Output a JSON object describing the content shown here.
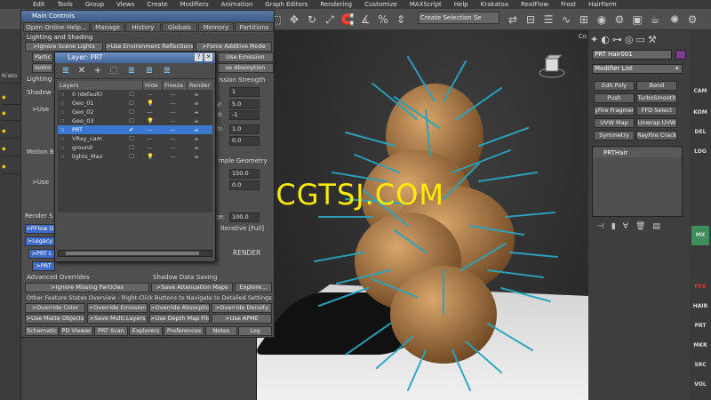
{
  "menu": [
    "Edit",
    "Tools",
    "Group",
    "Views",
    "Create",
    "Modifiers",
    "Animation",
    "Graph Editors",
    "Rendering",
    "Customize",
    "MAXScript",
    "Help",
    "Krakatoa",
    "RealFlow",
    "Frost",
    "HairFarm"
  ],
  "toolbar": {
    "selection_set": "Create Selection Se"
  },
  "left_strip": [
    "Krako",
    "Lighting",
    "Shadow"
  ],
  "main_controls": {
    "title": "Main Controls",
    "tabs": [
      "Open Online Help...",
      "Manage",
      "History",
      "Globals",
      "Memory",
      "Partitions"
    ],
    "lighting_section": "Lighting and Shading",
    "buttons_row1": [
      ">Ignore Scene Lights",
      ">Use Environment Reflections",
      ">Force Additive Mode"
    ],
    "partial_labels": [
      "Partic",
      "Isotro",
      "Lighting",
      "Shadow",
      "Motion B",
      "Render S"
    ],
    "use_labels": [
      ">Use",
      ">Use"
    ],
    "pflow": [
      ">PFlow G",
      ">Legacy",
      ">PRT L",
      ">PRT"
    ],
    "advanced_overrides": "Advanced Overrides",
    "ignore_missing": ">Ignore Missing Particles",
    "shadow_saving": "Shadow Data Saving",
    "save_atten": ">Save Attenuation Maps",
    "explore": "Explore...",
    "other_feature": "Other Feature States Overview - Right-Click Buttons to Navigate to Detailed Settings",
    "override_row1": [
      ">Override Color",
      ">Override Emission",
      ">Override Absorption",
      ">Override Density"
    ],
    "override_row2": [
      ">Use Matte Objects",
      ">Save Multi.Layers",
      ">Use Depth Map Files",
      ">Use APME"
    ],
    "bottom_tabs": [
      "Schematic",
      "PD Viewer",
      "PRT Scan",
      "Explorers",
      "Preferences",
      "Notes",
      "Log"
    ],
    "right_side": {
      "emission": "Use Emission",
      "absorption": "se Absorption",
      "mission_strength": "ission Strength",
      "sample_geometry": "mple Geometry",
      "iterative": "Iterative [Full]",
      "render": "RENDER",
      "fields": [
        "1",
        "5.0",
        "-1",
        "1.0",
        "0.0",
        "150.0",
        "0.0",
        "100.0"
      ],
      "field_labels": [
        "y:",
        "d:",
        "h:",
        "ge:"
      ]
    }
  },
  "layer_dialog": {
    "title": "Layer: PRT",
    "columns": [
      "Layers",
      "Hide",
      "Freeze",
      "Render"
    ],
    "rows": [
      "0 (default)",
      "Geo_01",
      "Geo_02",
      "Geo_03",
      "PRT",
      "VRay_cam",
      "ground",
      "lights_Max"
    ],
    "selected_row": 4
  },
  "viewport": {
    "label": "Co"
  },
  "command_panel": {
    "object_name": "PRT Hair001",
    "modifier_list": "Modifier List",
    "buttons": [
      [
        "Edit Poly",
        "Bend"
      ],
      [
        "Push",
        "TurboSmooth"
      ],
      [
        "yFire Fragmen",
        "FFD Select"
      ],
      [
        "UVW Map",
        "Unwrap UVW"
      ],
      [
        "Symmetry",
        "RayFire Cracks"
      ]
    ],
    "stack_item": "PRTHair"
  },
  "right_strip": [
    "CAM",
    "KOM",
    "DEL",
    "LOG",
    "MX",
    "FFX",
    "HAIR",
    "PRT",
    "MKR",
    "SRC",
    "VOL"
  ],
  "watermark": "WWW.CGTSJ.COM"
}
